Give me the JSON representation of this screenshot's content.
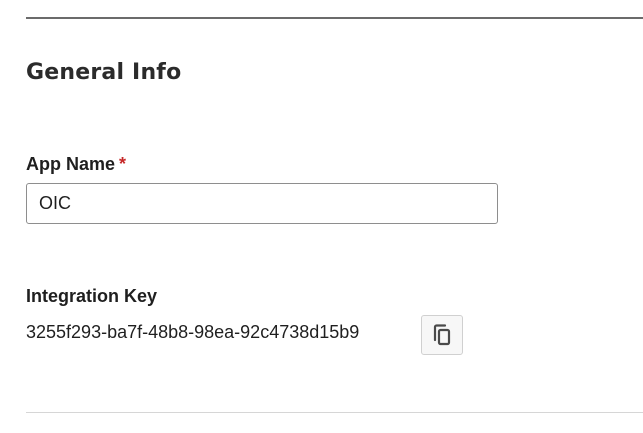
{
  "section": {
    "title": "General Info"
  },
  "app_name": {
    "label": "App Name",
    "required_mark": "*",
    "value": "OIC"
  },
  "integration_key": {
    "label": "Integration Key",
    "value": "3255f293-ba7f-48b8-98ea-92c4738d15b9",
    "copy_icon": "copy-icon"
  },
  "colors": {
    "required": "#c62828",
    "divider_top": "#6b6b6b",
    "divider_bottom": "#d6d6d6"
  }
}
